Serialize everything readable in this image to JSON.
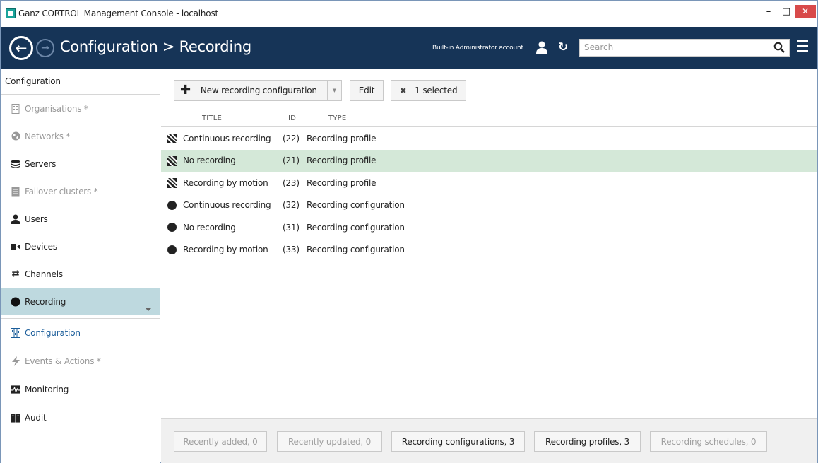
{
  "window": {
    "title": "Ganz CORTROL Management Console - localhost"
  },
  "header": {
    "title": "Configuration > Recording",
    "account": "Built-in Administrator account",
    "search_placeholder": "Search"
  },
  "sidebar": {
    "heading": "Configuration",
    "items": [
      {
        "label": "Organisations *",
        "icon": "building-icon",
        "disabled": true
      },
      {
        "label": "Networks *",
        "icon": "globe-icon",
        "disabled": true
      },
      {
        "label": "Servers",
        "icon": "servers-stack-icon",
        "disabled": false
      },
      {
        "label": "Failover clusters *",
        "icon": "cluster-icon",
        "disabled": true
      },
      {
        "label": "Users",
        "icon": "user-icon",
        "disabled": false
      },
      {
        "label": "Devices",
        "icon": "camera-icon",
        "disabled": false
      },
      {
        "label": "Channels",
        "icon": "shuffle-icon",
        "disabled": false
      },
      {
        "label": "Recording",
        "icon": "record-dot-icon",
        "disabled": false,
        "active": true
      }
    ],
    "sections": [
      {
        "label": "Configuration",
        "icon": "config-grid-icon",
        "selected": true
      },
      {
        "label": "Events & Actions *",
        "icon": "lightning-icon",
        "disabled": true
      },
      {
        "label": "Monitoring",
        "icon": "monitor-pulse-icon"
      },
      {
        "label": "Audit",
        "icon": "book-icon"
      }
    ]
  },
  "toolbar": {
    "new_label": "New recording configuration",
    "edit_label": "Edit",
    "selected_label": "1 selected"
  },
  "grid": {
    "columns": [
      "TITLE",
      "ID",
      "TYPE"
    ],
    "rows": [
      {
        "icon": "clapperboard-icon",
        "title": "Continuous recording",
        "id": "(22)",
        "type": "Recording profile",
        "selected": false
      },
      {
        "icon": "clapperboard-icon",
        "title": "No recording",
        "id": "(21)",
        "type": "Recording profile",
        "selected": true
      },
      {
        "icon": "clapperboard-icon",
        "title": "Recording by motion",
        "id": "(23)",
        "type": "Recording profile",
        "selected": false
      },
      {
        "icon": "record-dot-icon",
        "title": "Continuous recording",
        "id": "(32)",
        "type": "Recording configuration",
        "selected": false
      },
      {
        "icon": "record-dot-icon",
        "title": "No recording",
        "id": "(31)",
        "type": "Recording configuration",
        "selected": false
      },
      {
        "icon": "record-dot-icon",
        "title": "Recording by motion",
        "id": "(33)",
        "type": "Recording configuration",
        "selected": false
      }
    ]
  },
  "filters": [
    {
      "label": "Recently added, 0",
      "enabled": false
    },
    {
      "label": "Recently updated, 0",
      "enabled": false
    },
    {
      "label": "Recording configurations, 3",
      "enabled": true
    },
    {
      "label": "Recording profiles, 3",
      "enabled": true
    },
    {
      "label": "Recording schedules, 0",
      "enabled": false
    }
  ],
  "colors": {
    "header_bg": "#163457",
    "active_sidebar": "#bed9df",
    "selected_row": "#d4e8d8",
    "close_button": "#d84a4a"
  }
}
